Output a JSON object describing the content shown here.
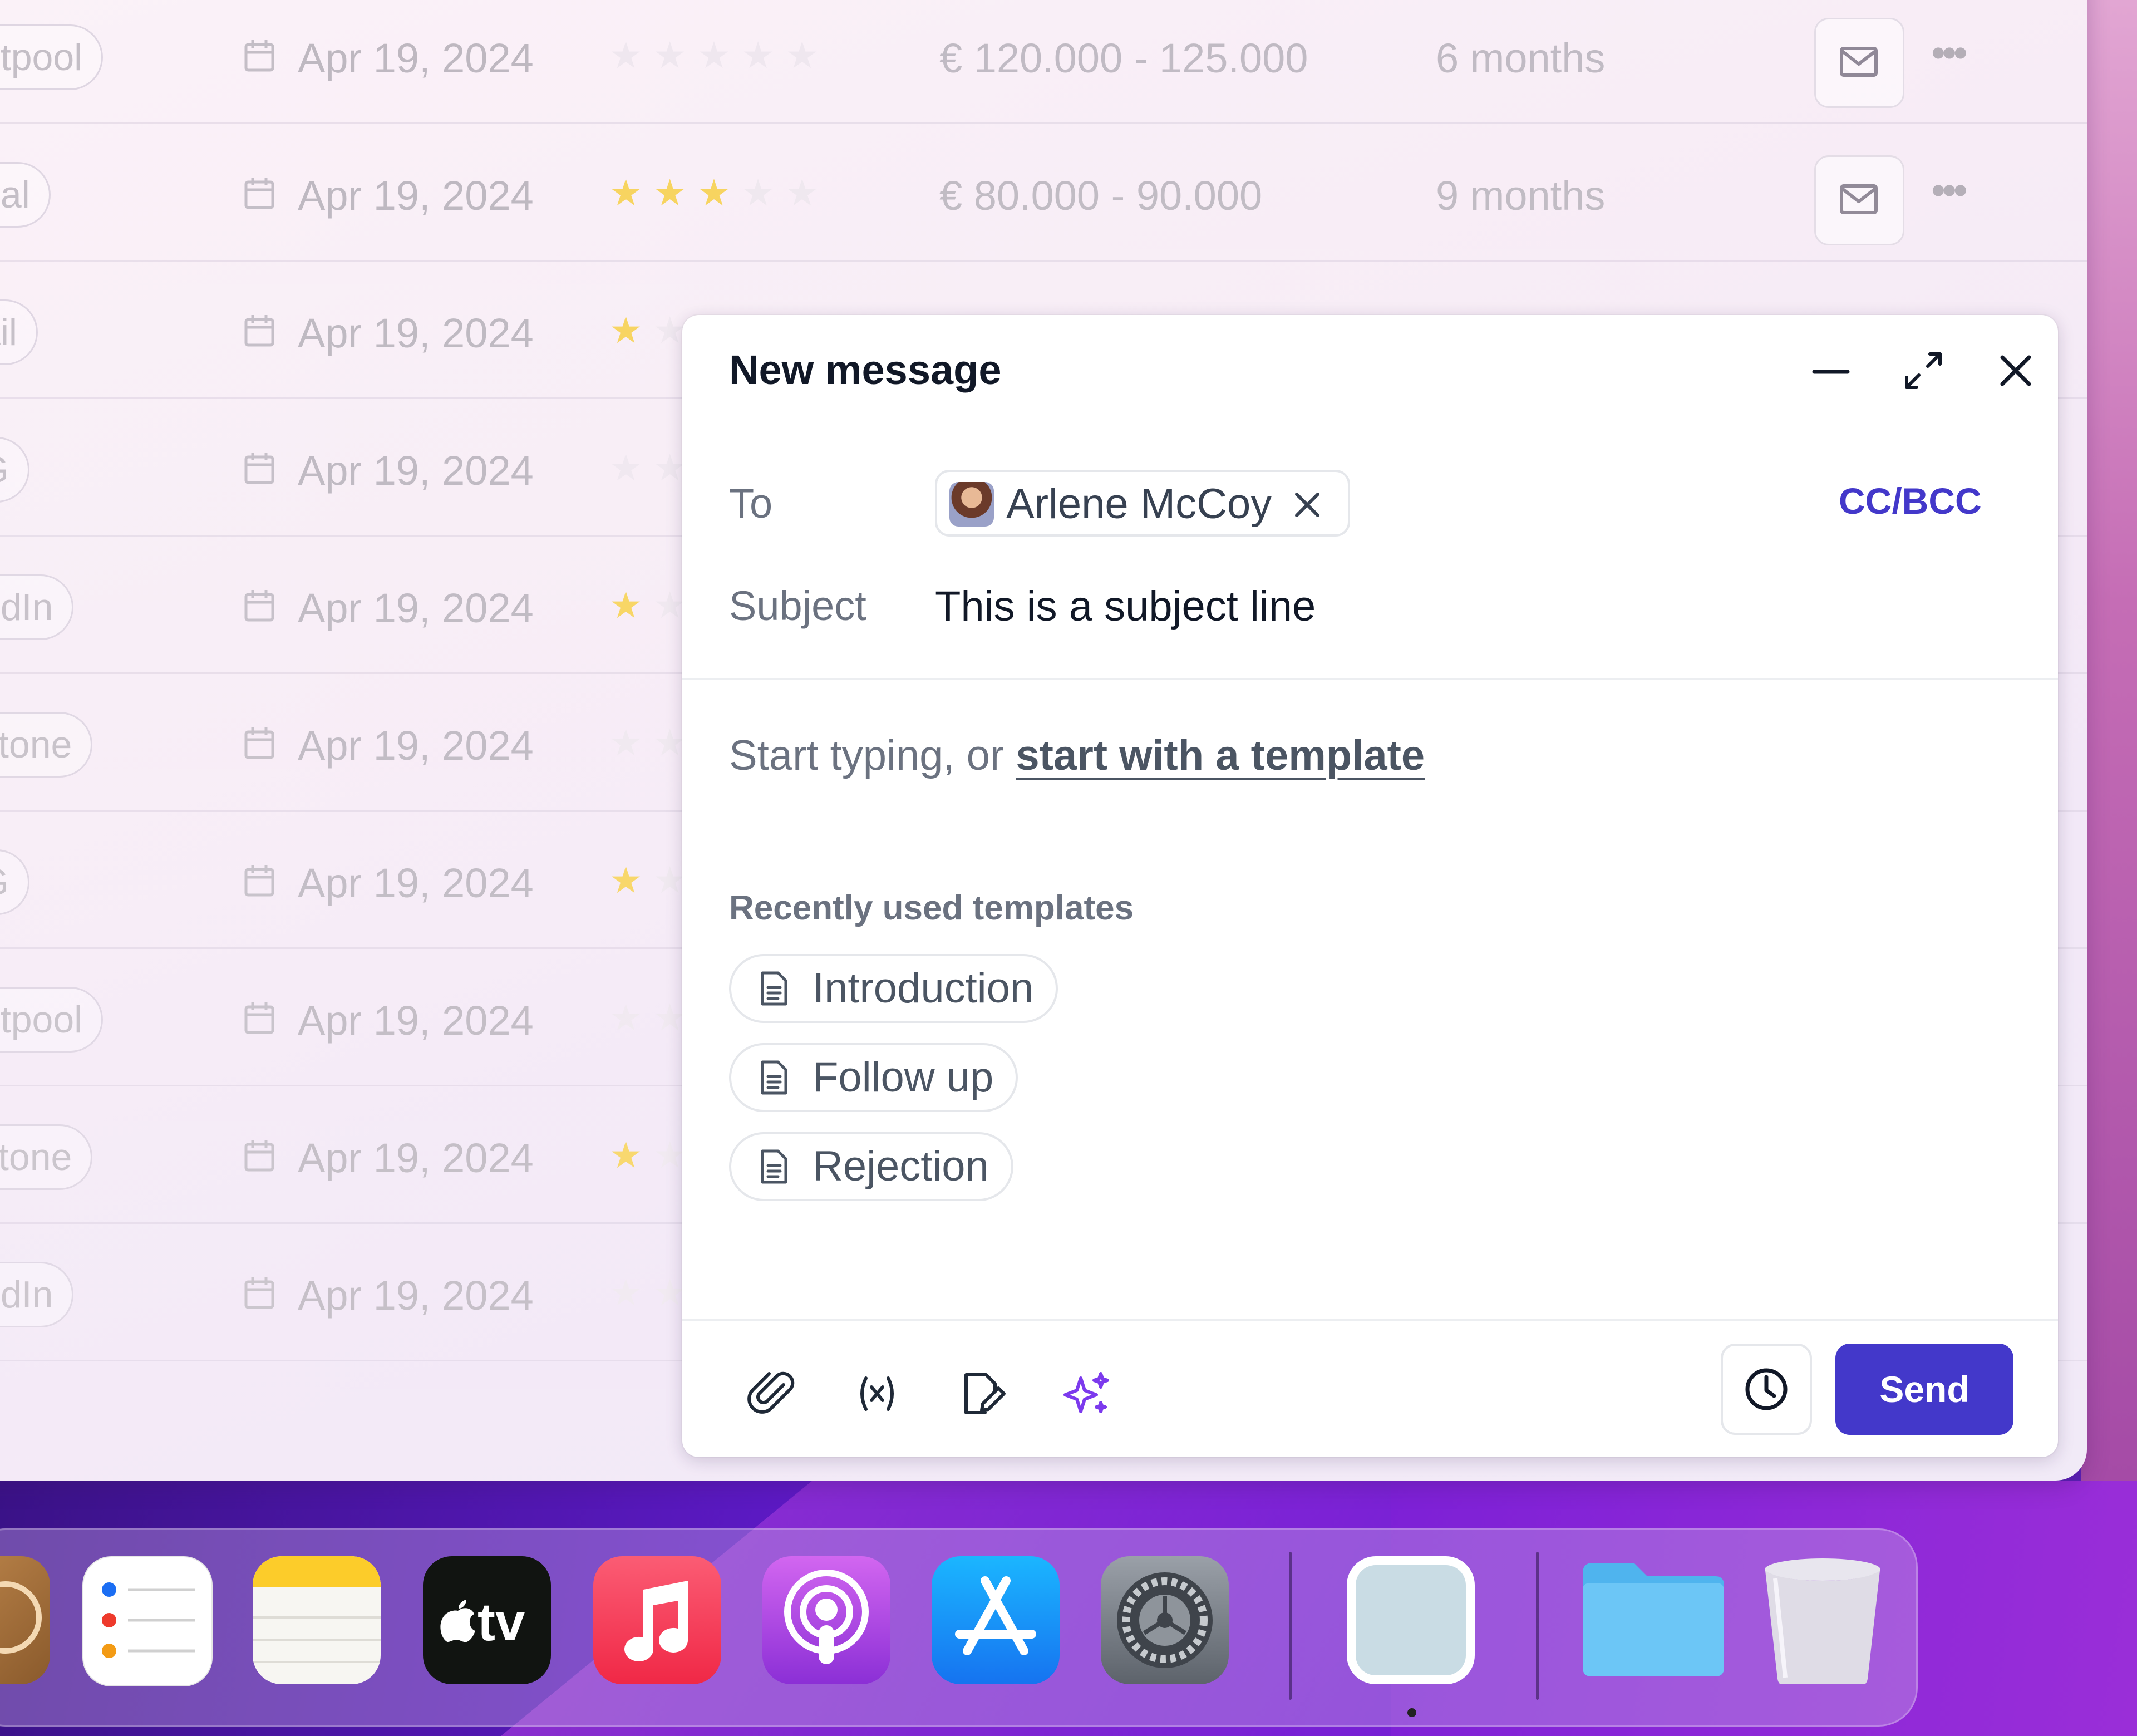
{
  "background_rows": [
    {
      "source": "ntpool",
      "date": "Apr 19, 2024",
      "rating": 0,
      "salary": "€ 120.000 - 125.000",
      "duration": "6 months"
    },
    {
      "source": "nal",
      "date": "Apr 19, 2024",
      "rating": 3,
      "salary": "€ 80.000 - 90.000",
      "duration": "9 months"
    },
    {
      "source": "ail",
      "date": "Apr 19, 2024",
      "rating": 1,
      "salary": "",
      "duration": ""
    },
    {
      "source": "G",
      "date": "Apr 19, 2024",
      "rating": 0,
      "salary": "",
      "duration": ""
    },
    {
      "source": "edIn",
      "date": "Apr 19, 2024",
      "rating": 1,
      "salary": "",
      "duration": ""
    },
    {
      "source": "stone",
      "date": "Apr 19, 2024",
      "rating": 0,
      "salary": "",
      "duration": ""
    },
    {
      "source": "G",
      "date": "Apr 19, 2024",
      "rating": 1,
      "salary": "",
      "duration": ""
    },
    {
      "source": "ntpool",
      "date": "Apr 19, 2024",
      "rating": 0,
      "salary": "",
      "duration": ""
    },
    {
      "source": "stone",
      "date": "Apr 19, 2024",
      "rating": 1,
      "salary": "",
      "duration": ""
    },
    {
      "source": "edIn",
      "date": "Apr 19, 2024",
      "rating": 0,
      "salary": "",
      "duration": ""
    }
  ],
  "compose": {
    "title": "New message",
    "to_label": "To",
    "recipient_name": "Arlene McCoy",
    "cc_bcc_label": "CC/BCC",
    "subject_label": "Subject",
    "subject_value": "This is a subject line",
    "body_placeholder_prefix": "Start typing, or ",
    "body_template_link": "start with a template",
    "recent_templates_heading": "Recently used templates",
    "templates": [
      "Introduction",
      "Follow up",
      "Rejection"
    ],
    "send_label": "Send",
    "accent_color": "#4338ca"
  },
  "dock": {
    "apps": [
      "Contacts",
      "Reminders",
      "Notes",
      "TV",
      "Music",
      "Podcasts",
      "App Store",
      "System Settings",
      "Preview",
      "Files",
      "Trash"
    ],
    "tv_label": "tv"
  }
}
